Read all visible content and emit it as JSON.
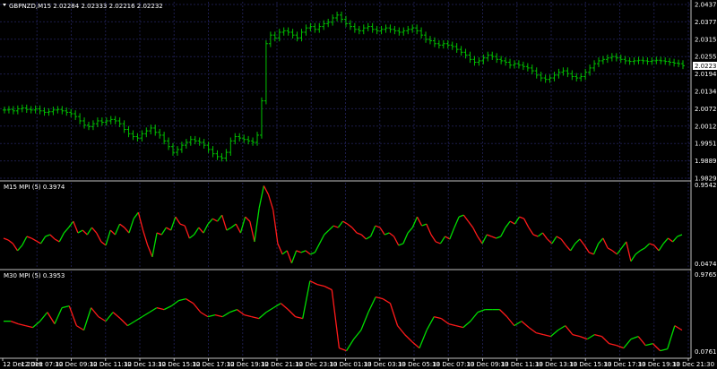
{
  "main": {
    "label": "GBPNZD,M15  2.02284 2.02333 2.02216 2.02232",
    "price_axis": [
      "2.04370",
      "2.03770",
      "2.03155",
      "2.02555",
      "2.01940",
      "2.01340",
      "2.00725",
      "2.00125",
      "1.99510",
      "1.98895",
      "1.98295"
    ],
    "current_price": "2.02232",
    "colors": {
      "bars": "#00c000",
      "grid": "#1c1c4a",
      "axis": "#c0c0c0",
      "current_bg": "#ffffff",
      "current_fg": "#000000"
    }
  },
  "indicator1": {
    "label": "M15 MPI (5) 0.3974",
    "scale": [
      "0.9542",
      "0.0474"
    ],
    "colors": {
      "up": "#00dd00",
      "down": "#ff1a1a"
    }
  },
  "indicator2": {
    "label": "M30 MPI (5) 0.3953",
    "scale": [
      "0.9765",
      "0.0761"
    ],
    "colors": {
      "up": "#00dd00",
      "down": "#ff1a1a"
    }
  },
  "time_axis": [
    "12 Dec 2019",
    "12 Dec 07:30",
    "12 Dec 09:30",
    "12 Dec 11:30",
    "12 Dec 13:30",
    "12 Dec 15:30",
    "12 Dec 17:30",
    "12 Dec 19:30",
    "12 Dec 21:30",
    "12 Dec 23:30",
    "13 Dec 01:30",
    "13 Dec 03:30",
    "13 Dec 05:30",
    "13 Dec 07:30",
    "13 Dec 09:30",
    "13 Dec 11:30",
    "13 Dec 13:30",
    "13 Dec 15:30",
    "13 Dec 17:30",
    "13 Dec 19:30",
    "13 Dec 21:30"
  ],
  "chart_data": [
    {
      "type": "candlestick",
      "title": "GBPNZD,M15",
      "ylim": [
        1.98295,
        2.0437
      ],
      "series": [
        {
          "values": [
            2.0068,
            2.007,
            2.0065,
            2.0072,
            2.0075,
            2.007,
            2.0068,
            2.0072,
            2.0065,
            2.006,
            2.0062,
            2.0068,
            2.007,
            2.0065,
            2.006,
            2.0055,
            2.0045,
            2.003,
            2.0015,
            2.001,
            2.002,
            2.003,
            2.0025,
            2.003,
            2.0035,
            2.003,
            2.002,
            2.0,
            1.9985,
            1.9975,
            1.997,
            1.9985,
            1.9995,
            2.0005,
            1.999,
            1.998,
            1.996,
            1.994,
            1.992,
            1.993,
            1.9945,
            1.9955,
            1.9965,
            1.996,
            1.9955,
            1.9945,
            1.993,
            1.9915,
            1.9905,
            1.99,
            1.992,
            1.996,
            1.9975,
            1.997,
            1.9965,
            1.996,
            1.9955,
            1.998,
            2.01,
            2.03,
            2.033,
            2.032,
            2.034,
            2.0345,
            2.034,
            2.033,
            2.032,
            2.034,
            2.0355,
            2.036,
            2.035,
            2.036,
            2.037,
            2.0375,
            2.039,
            2.04,
            2.0385,
            2.037,
            2.036,
            2.035,
            2.0345,
            2.0355,
            2.036,
            2.035,
            2.0345,
            2.035,
            2.0355,
            2.035,
            2.0345,
            2.034,
            2.0345,
            2.035,
            2.0355,
            2.0345,
            2.033,
            2.0315,
            2.031,
            2.03,
            2.0295,
            2.03,
            2.0295,
            2.029,
            2.028,
            2.027,
            2.026,
            2.0245,
            2.0235,
            2.024,
            2.025,
            2.026,
            2.0255,
            2.0245,
            2.024,
            2.0235,
            2.0225,
            2.023,
            2.0225,
            2.022,
            2.0215,
            2.0205,
            2.019,
            2.018,
            2.0175,
            2.018,
            2.019,
            2.02,
            2.0205,
            2.0195,
            2.0185,
            2.018,
            2.0185,
            2.02,
            2.0215,
            2.023,
            2.024,
            2.0245,
            2.025,
            2.0255,
            2.025,
            2.0245,
            2.024,
            2.0238,
            2.024,
            2.0242,
            2.024,
            2.0238,
            2.024,
            2.0242,
            2.024,
            2.0238,
            2.0235,
            2.0232,
            2.023,
            2.0223
          ]
        }
      ]
    },
    {
      "type": "line",
      "title": "M15 MPI (5) 0.3974",
      "ylim": [
        0.0474,
        0.9542
      ],
      "series": [
        {
          "values": [
            0.36,
            0.34,
            0.3,
            0.22,
            0.28,
            0.38,
            0.36,
            0.33,
            0.3,
            0.38,
            0.4,
            0.35,
            0.32,
            0.42,
            0.48,
            0.55,
            0.42,
            0.45,
            0.4,
            0.48,
            0.42,
            0.32,
            0.28,
            0.45,
            0.4,
            0.52,
            0.48,
            0.42,
            0.58,
            0.65,
            0.45,
            0.28,
            0.15,
            0.42,
            0.4,
            0.48,
            0.45,
            0.6,
            0.52,
            0.5,
            0.36,
            0.4,
            0.48,
            0.42,
            0.52,
            0.58,
            0.55,
            0.62,
            0.45,
            0.48,
            0.52,
            0.42,
            0.6,
            0.55,
            0.32,
            0.7,
            0.95,
            0.85,
            0.68,
            0.3,
            0.18,
            0.22,
            0.08,
            0.22,
            0.2,
            0.22,
            0.18,
            0.2,
            0.3,
            0.4,
            0.45,
            0.5,
            0.48,
            0.55,
            0.52,
            0.48,
            0.42,
            0.4,
            0.35,
            0.38,
            0.5,
            0.48,
            0.4,
            0.42,
            0.38,
            0.28,
            0.3,
            0.42,
            0.48,
            0.6,
            0.5,
            0.52,
            0.4,
            0.32,
            0.3,
            0.38,
            0.35,
            0.48,
            0.6,
            0.62,
            0.55,
            0.48,
            0.38,
            0.3,
            0.4,
            0.38,
            0.36,
            0.38,
            0.48,
            0.55,
            0.52,
            0.6,
            0.58,
            0.48,
            0.4,
            0.38,
            0.42,
            0.35,
            0.3,
            0.38,
            0.35,
            0.28,
            0.22,
            0.3,
            0.35,
            0.28,
            0.2,
            0.18,
            0.3,
            0.36,
            0.25,
            0.22,
            0.18,
            0.25,
            0.32,
            0.1,
            0.18,
            0.22,
            0.25,
            0.3,
            0.28,
            0.22,
            0.3,
            0.36,
            0.32,
            0.38,
            0.4
          ]
        }
      ]
    },
    {
      "type": "line",
      "title": "M30 MPI (5) 0.3953",
      "ylim": [
        0.0761,
        0.9765
      ],
      "series": [
        {
          "values": [
            0.45,
            0.45,
            0.42,
            0.4,
            0.38,
            0.45,
            0.55,
            0.42,
            0.6,
            0.62,
            0.4,
            0.35,
            0.6,
            0.5,
            0.45,
            0.55,
            0.48,
            0.4,
            0.45,
            0.5,
            0.55,
            0.6,
            0.58,
            0.62,
            0.68,
            0.7,
            0.65,
            0.55,
            0.5,
            0.52,
            0.5,
            0.55,
            0.58,
            0.52,
            0.5,
            0.48,
            0.55,
            0.6,
            0.65,
            0.58,
            0.5,
            0.48,
            0.9,
            0.86,
            0.84,
            0.8,
            0.15,
            0.12,
            0.25,
            0.35,
            0.55,
            0.72,
            0.7,
            0.65,
            0.4,
            0.3,
            0.22,
            0.15,
            0.35,
            0.5,
            0.48,
            0.42,
            0.4,
            0.38,
            0.45,
            0.55,
            0.58,
            0.58,
            0.58,
            0.5,
            0.4,
            0.45,
            0.38,
            0.32,
            0.3,
            0.28,
            0.35,
            0.4,
            0.3,
            0.28,
            0.25,
            0.3,
            0.28,
            0.2,
            0.18,
            0.15,
            0.25,
            0.28,
            0.18,
            0.2,
            0.12,
            0.14,
            0.4,
            0.35
          ]
        }
      ]
    }
  ]
}
